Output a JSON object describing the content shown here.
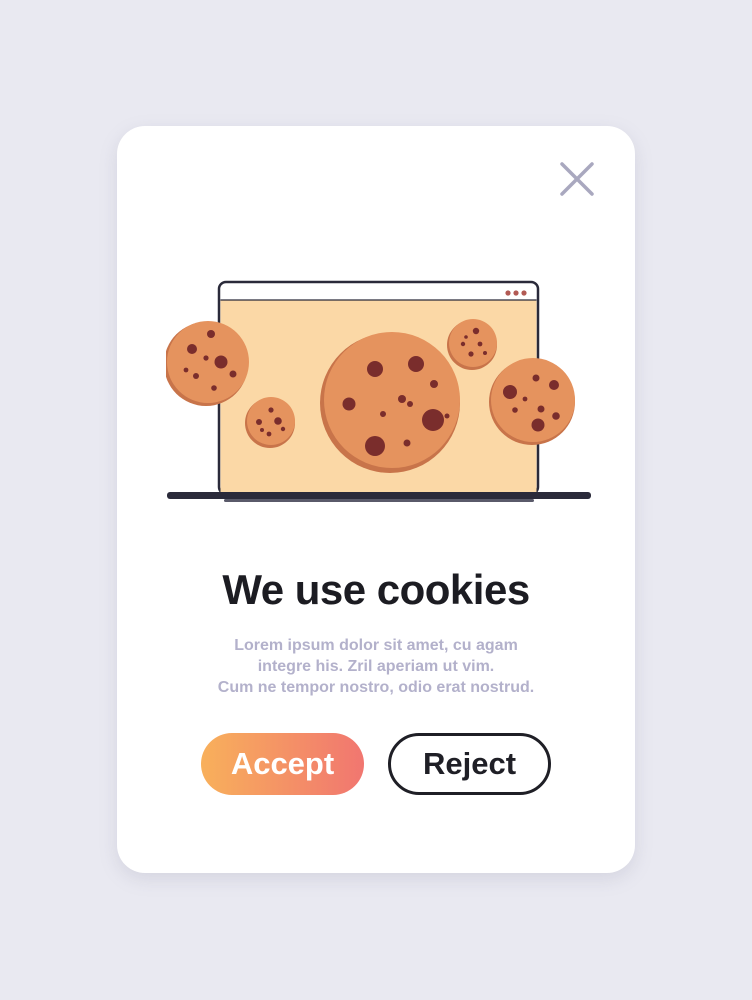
{
  "dialog": {
    "title": "We use cookies",
    "description_lines": [
      "Lorem ipsum dolor sit amet, cu agam",
      "integre his. Zril aperiam ut vim.",
      "Cum ne tempor nostro, odio erat nostrud."
    ],
    "accept_label": "Accept",
    "reject_label": "Reject",
    "close_icon": "close-icon",
    "illustration": "laptop-with-cookies"
  },
  "colors": {
    "background": "#e9e9f1",
    "card": "#ffffff",
    "title": "#1c1c22",
    "description": "#b3b1cb",
    "accept_gradient_start": "#f8b05b",
    "accept_gradient_end": "#f17670",
    "reject_border": "#1f1f26",
    "close_icon": "#a9a8bf",
    "screen": "#fbd8a6",
    "cookie": "#e5935e",
    "cookie_chip": "#7a2d2c"
  }
}
